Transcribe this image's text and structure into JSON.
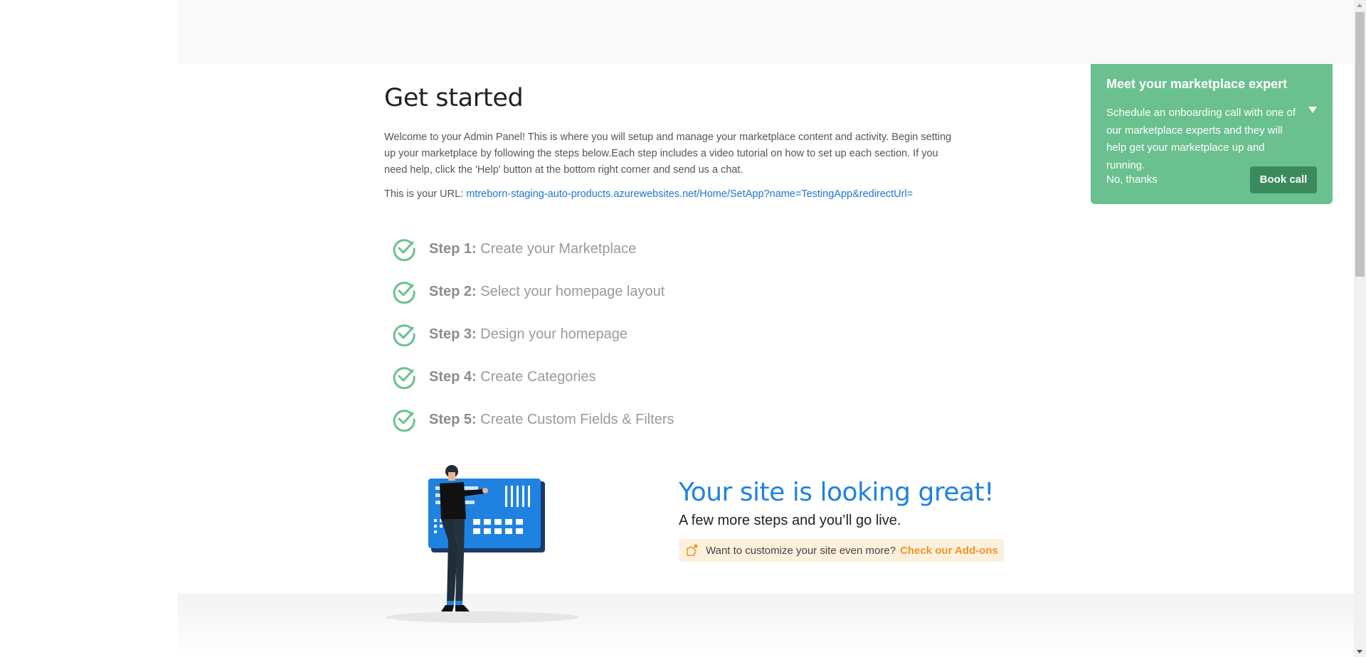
{
  "page": {
    "title": "Get started",
    "intro": "Welcome to your Admin Panel! This is where you will setup and manage your marketplace content and activity. Begin setting up your marketplace by following the steps below.Each step includes a video tutorial on how to set up each section. If you need help, click the 'Help' button at the bottom right corner and send us a chat.",
    "url_label": "This is your URL:",
    "url": "mtreborn-staging-auto-products.azurewebsites.net/Home/SetApp?name=TestingApp&redirectUrl="
  },
  "steps": [
    {
      "prefix": "Step 1:",
      "label": "Create your Marketplace",
      "completed": true
    },
    {
      "prefix": "Step 2:",
      "label": "Select your homepage layout",
      "completed": true
    },
    {
      "prefix": "Step 3:",
      "label": "Design your homepage",
      "completed": true
    },
    {
      "prefix": "Step 4:",
      "label": "Create Categories",
      "completed": true
    },
    {
      "prefix": "Step 5:",
      "label": "Create Custom Fields & Filters",
      "completed": true
    }
  ],
  "promo": {
    "headline": "Your site is looking great!",
    "subline": "A few more steps and you’ll go live.",
    "addon_text": "Want to customize your site even more?",
    "addon_link": "Check our Add-ons"
  },
  "expert_panel": {
    "title": "Meet your marketplace expert",
    "body": "Schedule an onboarding call with one of our marketplace experts and they will help get your marketplace up and running.",
    "dismiss_label": "No, thanks",
    "book_label": "Book call"
  },
  "colors": {
    "accent_blue": "#1f82e0",
    "check_green": "#6ac08e",
    "addon_orange": "#f0962b",
    "panel_green": "#6ac08e"
  },
  "icons": {
    "step_status": "check-circle-icon",
    "addon": "puzzle-icon",
    "collapse": "caret-down-icon"
  }
}
